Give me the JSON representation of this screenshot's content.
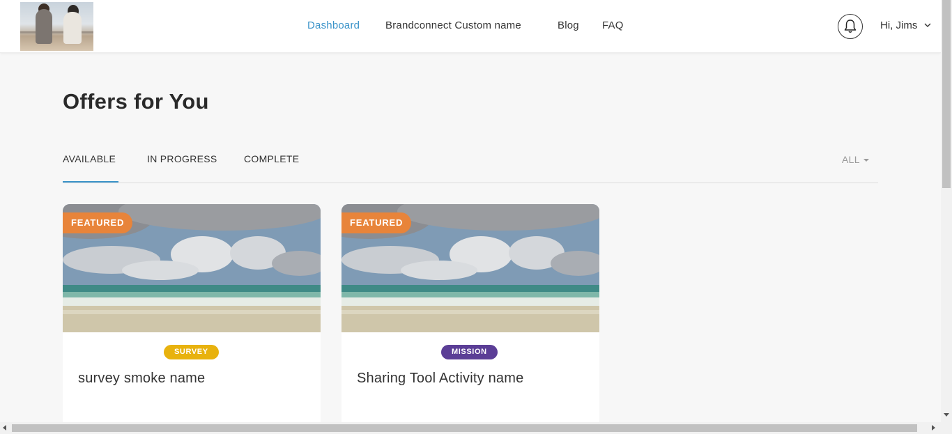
{
  "header": {
    "nav": [
      "Dashboard",
      "Brandconnect Custom name",
      "Blog",
      "FAQ"
    ],
    "active_nav": "Dashboard",
    "greeting": "Hi, Jims",
    "icons": {
      "notifications": "bell-icon",
      "menu": "chevron-down-icon"
    }
  },
  "main": {
    "title": "Offers for You",
    "tabs": [
      "AVAILABLE",
      "IN PROGRESS",
      "COMPLETE"
    ],
    "active_tab": "AVAILABLE",
    "filter": "ALL"
  },
  "offers": [
    {
      "badge": "FEATURED",
      "type": "SURVEY",
      "type_color": "#e8b20e",
      "title": "survey smoke name"
    },
    {
      "badge": "FEATURED",
      "type": "MISSION",
      "type_color": "#5b3e96",
      "title": "Sharing Tool Activity name"
    }
  ],
  "colors": {
    "accent": "#3a93c9",
    "featured": "#e8843a"
  }
}
